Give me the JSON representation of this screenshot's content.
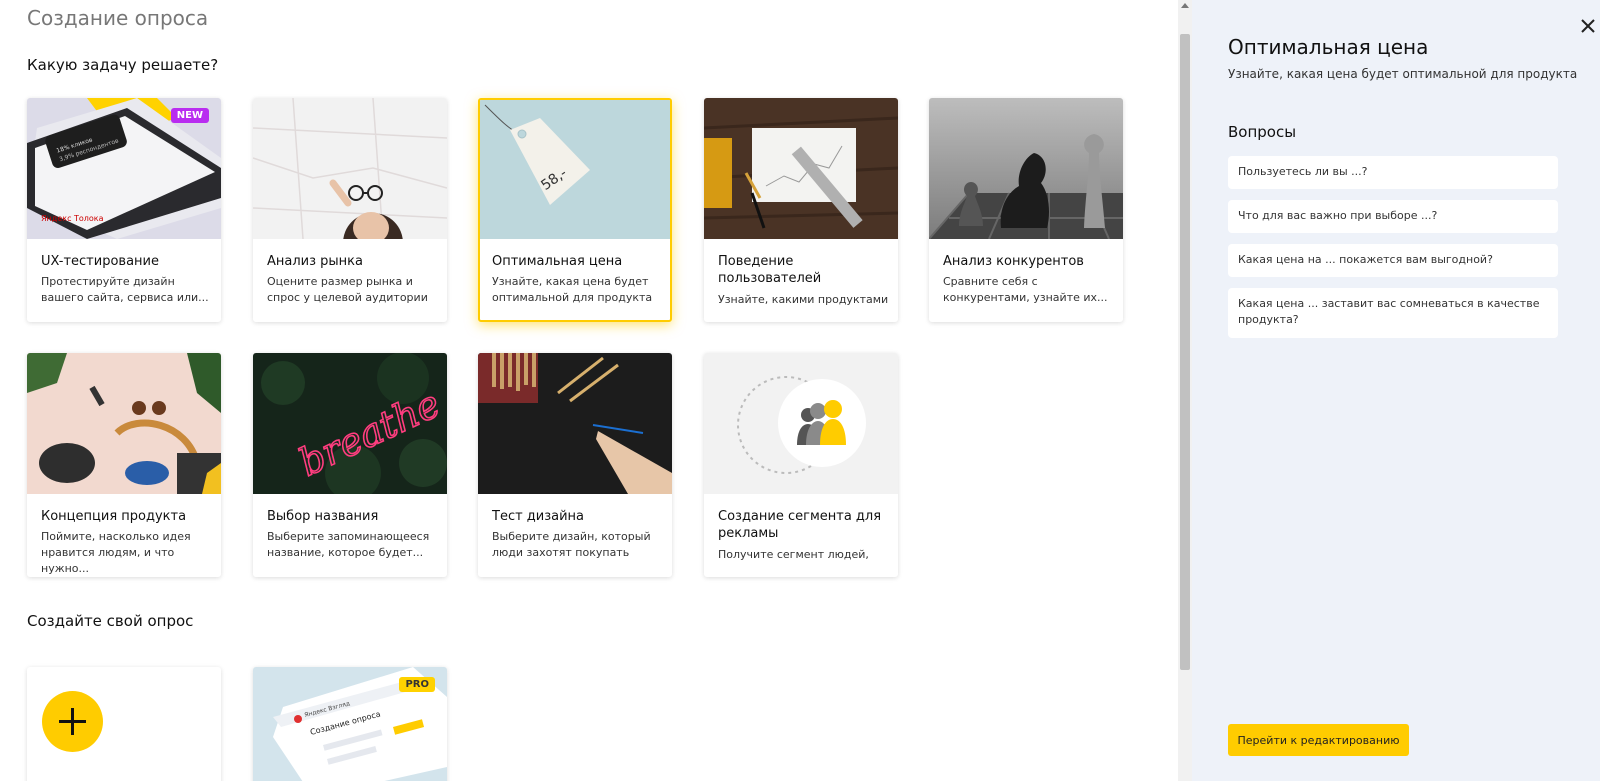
{
  "page": {
    "title": "Создание опроса"
  },
  "sections": {
    "tasks": "Какую задачу решаете?",
    "custom": "Создайте свой опрос"
  },
  "cards": [
    {
      "title": "UX-тестирование",
      "desc": "Протестируйте дизайн вашего сайта, сервиса или...",
      "badge": "NEW",
      "image_text": [
        "18% кликов",
        "3,9% респондентов",
        "Яндекс Толока"
      ]
    },
    {
      "title": "Анализ рынка",
      "desc": "Оцените размер рынка и спрос у целевой аудитории"
    },
    {
      "title": "Оптимальная цена",
      "desc": "Узнайте, какая цена будет оптимальной для продукта",
      "image_text": "58,-"
    },
    {
      "title": "Поведение пользователей",
      "desc": "Узнайте, какими продуктами"
    },
    {
      "title": "Анализ конкурентов",
      "desc": "Сравните себя с конкурентами, узнайте их..."
    },
    {
      "title": "Концепция продукта",
      "desc": "Поймите, насколько идея нравится людям, и что нужно..."
    },
    {
      "title": "Выбор названия",
      "desc": "Выберите запоминающееся название, которое будет...",
      "image_text": "breathe"
    },
    {
      "title": "Тест дизайна",
      "desc": "Выберите дизайн, который люди захотят покупать"
    },
    {
      "title": "Создание сегмента для рекламы",
      "desc": "Получите сегмент людей,"
    }
  ],
  "custom_cards": {
    "pro_badge": "PRO",
    "pro_image_text": [
      "Яндекс Взгляд",
      "Создание опроса"
    ]
  },
  "panel": {
    "title": "Оптимальная цена",
    "subtitle": "Узнайте, какая цена будет оптимальной для продукта",
    "questions_title": "Вопросы",
    "questions": [
      "Пользуетесь ли вы ...?",
      "Что для вас важно при выборе ...?",
      "Какая цена на ... покажется вам выгодной?",
      "Какая цена ... заставит вас сомневаться в качестве продукта?"
    ],
    "edit_button": "Перейти к редактированию"
  },
  "colors": {
    "accent": "#ffcc00",
    "new_badge": "#b92cf0",
    "panel_bg": "#eef2f9"
  }
}
